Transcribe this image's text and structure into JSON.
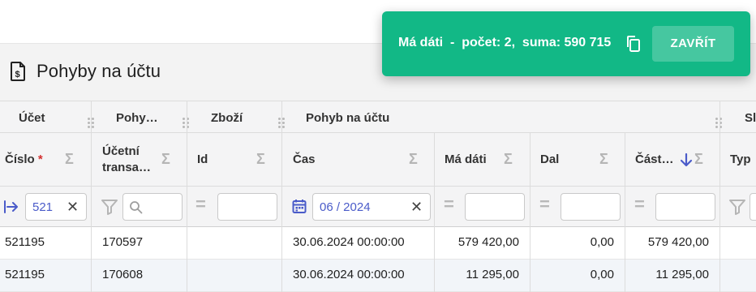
{
  "page": {
    "title": "Pohyby na účtu"
  },
  "toast": {
    "label": "Má dáti",
    "separator": "-",
    "count_text": "počet: 2,",
    "sum_text": "suma: 590 715",
    "close_label": "ZAVŘÍT",
    "background_color": "#12b886"
  },
  "grid": {
    "groups": [
      "Účet",
      "Pohy…",
      "Zboží",
      "Pohyb na účtu",
      "Sl"
    ],
    "columns": {
      "cislo": "Číslo",
      "required_mark": "*",
      "ucetni_1": "Účetní",
      "ucetni_2": "transa…",
      "id": "Id",
      "cas": "Čas",
      "ma_dati": "Má dáti",
      "dal": "Dal",
      "castka": "Část…",
      "typ": "Typ"
    },
    "sigma": "Σ",
    "filters": {
      "cislo_value": "521",
      "cas_value": "06 / 2024",
      "clear": "✕",
      "equals": "="
    },
    "rows": [
      {
        "cislo": "521195",
        "transakce": "170597",
        "id": "",
        "cas": "30.06.2024 00:00:00",
        "ma_dati": "579 420,00",
        "dal": "0,00",
        "castka": "579 420,00"
      },
      {
        "cislo": "521195",
        "transakce": "170608",
        "id": "",
        "cas": "30.06.2024 00:00:00",
        "ma_dati": "11 295,00",
        "dal": "0,00",
        "castka": "11 295,00"
      }
    ]
  },
  "colors": {
    "accent": "#4a5bc9",
    "required": "#d32f2f",
    "sort_arrow": "#4a5bc9"
  }
}
